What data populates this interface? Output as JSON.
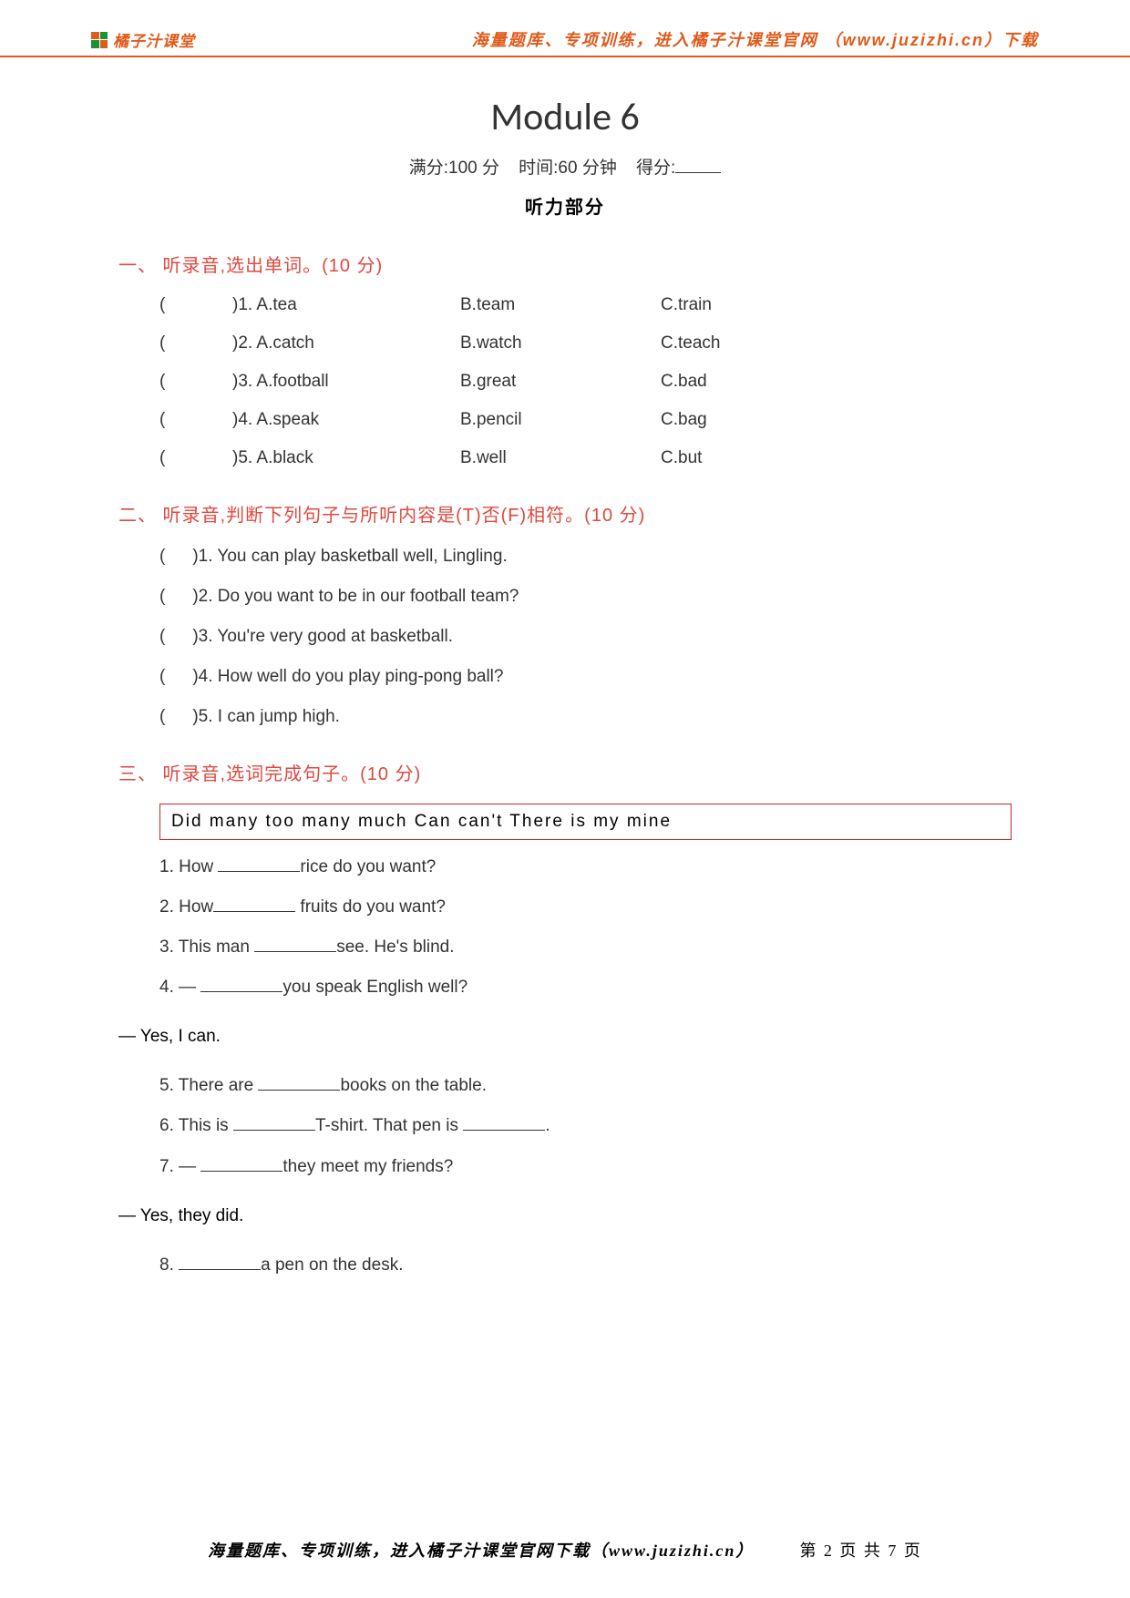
{
  "header": {
    "logo_text": "橘子汁课堂",
    "right_text": "海量题库、专项训练，进入橘子汁课堂官网 （www.juzizhi.cn）下载"
  },
  "title": "Module 6",
  "meta": {
    "full": "满分:100 分",
    "time": "时间:60 分钟",
    "score_label": "得分:"
  },
  "section_title": "听力部分",
  "q1": {
    "head": "一、 听录音,选出单词。(10 分)",
    "rows": [
      {
        "num": ")1.",
        "a": "A.tea",
        "b": "B.team",
        "c": "C.train"
      },
      {
        "num": ")2.",
        "a": "A.catch",
        "b": "B.watch",
        "c": "C.teach"
      },
      {
        "num": ")3.",
        "a": "A.football",
        "b": "B.great",
        "c": "C.bad"
      },
      {
        "num": ")4.",
        "a": "A.speak",
        "b": "B.pencil",
        "c": "C.bag"
      },
      {
        "num": ")5.",
        "a": "A.black",
        "b": "B.well",
        "c": "C.but"
      }
    ]
  },
  "q2": {
    "head": "二、 听录音,判断下列句子与所听内容是(T)否(F)相符。(10 分)",
    "rows": [
      ")1. You can play basketball well, Lingling.",
      ")2. Do you want to be in our football team?",
      ")3. You're very good at basketball.",
      ")4. How well do you play ping-pong ball?",
      ")5. I can jump high."
    ]
  },
  "q3": {
    "head": "三、 听录音,选词完成句子。(10 分)",
    "word_box": "Did   many   too many   much   Can   can't   There is   my   mine",
    "items": {
      "i1_pre": "1. How ",
      "i1_post": "rice do you want?",
      "i2_pre": "2. How",
      "i2_post": " fruits do you want?",
      "i3_pre": "3. This man ",
      "i3_post": "see. He's blind.",
      "i4_pre": "4. — ",
      "i4_post": "you speak English well?",
      "yes1": "— Yes, I can.",
      "i5_pre": "5. There are ",
      "i5_post": "books on the table.",
      "i6_pre": "6. This is ",
      "i6_mid": "T-shirt. That pen is ",
      "i6_post": ".",
      "i7_pre": "7. — ",
      "i7_post": "they meet my friends?",
      "yes2": "— Yes, they did.",
      "i8_pre": "8. ",
      "i8_post": "a pen on the desk."
    }
  },
  "footer": {
    "left": "海量题库、专项训练，进入橘子汁课堂官网下载（www.juzizhi.cn）",
    "right": "第 2 页 共 7 页"
  }
}
